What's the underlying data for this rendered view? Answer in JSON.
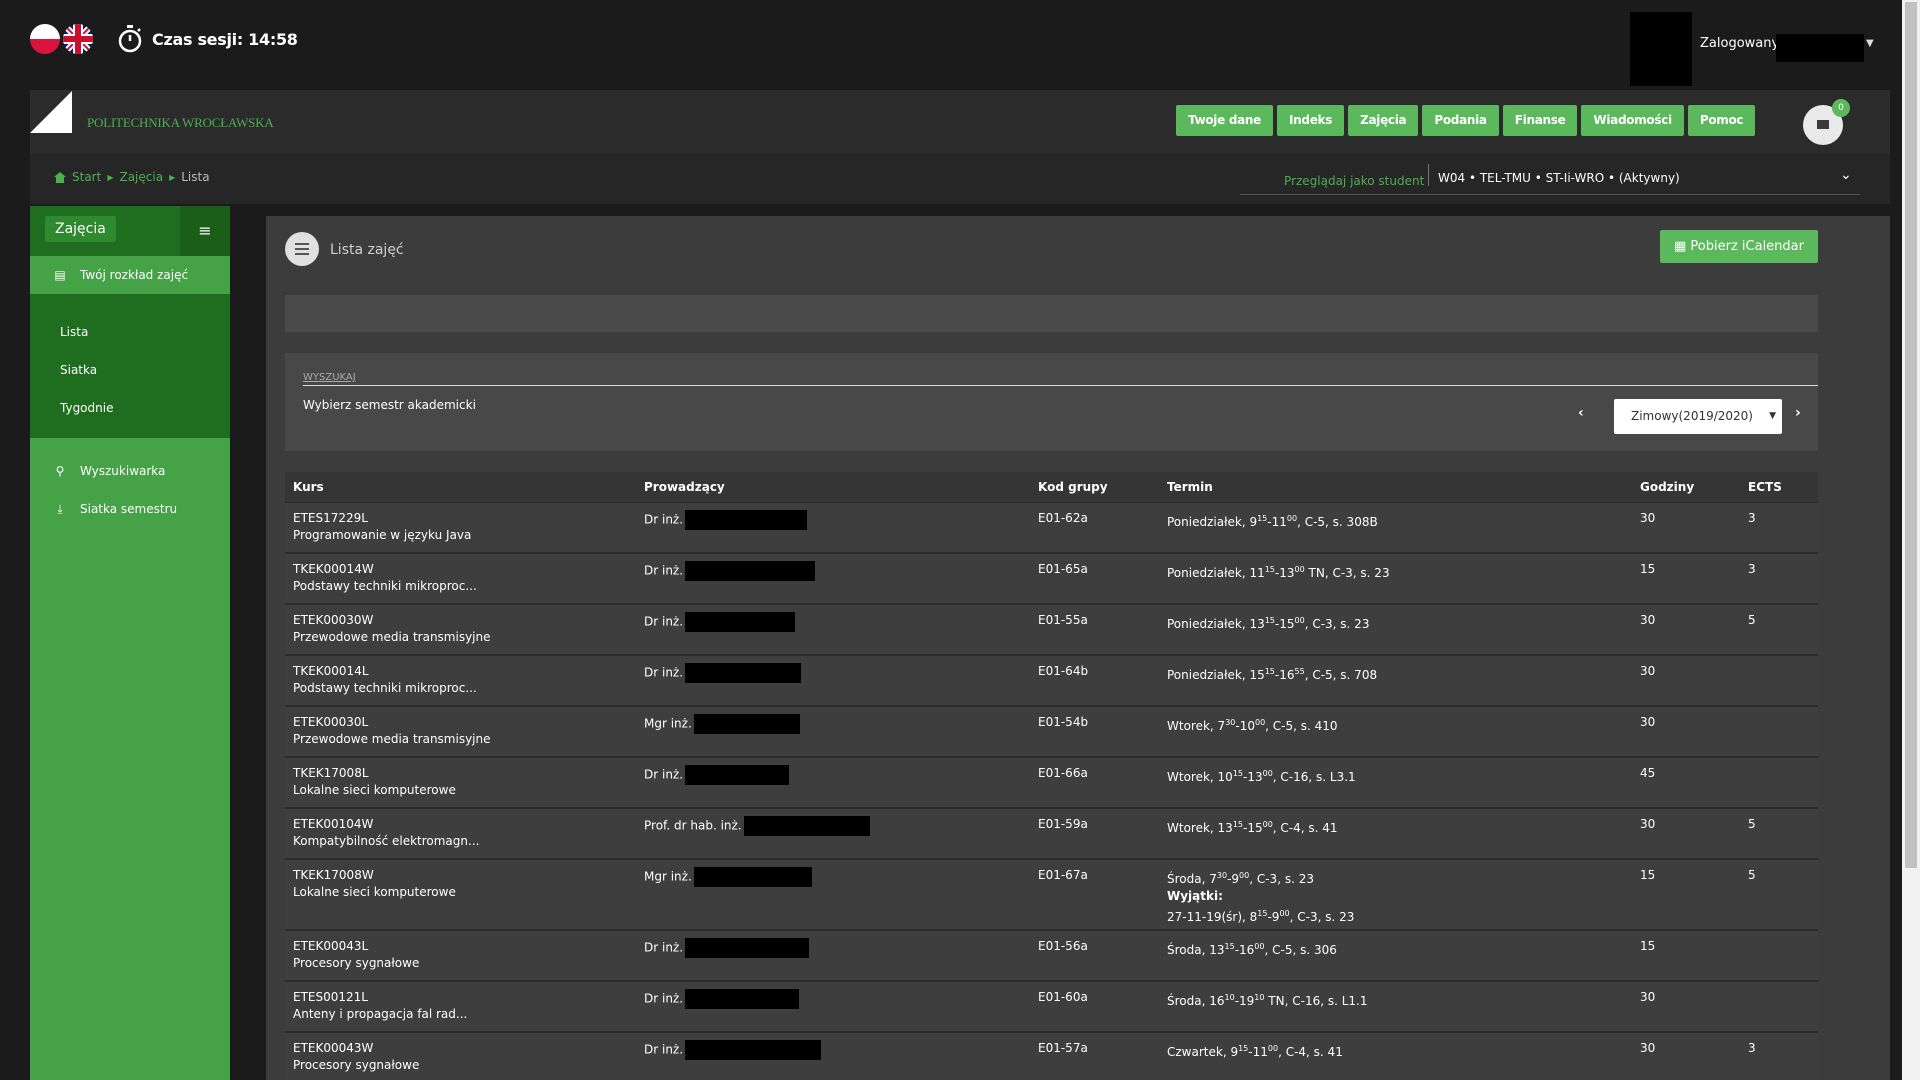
{
  "header": {
    "session_label": "Czas sesji: 14:58",
    "logged_label": "Zalogowany",
    "logo_text": "POLITECHNIKA WROCŁAWSKA",
    "nav": [
      "Twoje dane",
      "Indeks",
      "Zajęcia",
      "Podania",
      "Finanse",
      "Wiadomości",
      "Pomoc"
    ],
    "mail_count": "0"
  },
  "breadcrumb": {
    "start": "Start",
    "zajecia": "Zajęcia",
    "current": "Lista"
  },
  "view_as": {
    "label": "Przeglądaj jako student",
    "value": "W04 • TEL-TMU • ST-Ii-WRO • (Aktywny)"
  },
  "sidebar": {
    "title": "Zajęcia",
    "toggle": "≡",
    "schedule": "Twój rozkład zajęć",
    "sub": [
      "Lista",
      "Siatka",
      "Tygodnie"
    ],
    "search": "Wyszukiwarka",
    "semester_grid": "Siatka semestru"
  },
  "main": {
    "title": "Lista zajęć",
    "ical_button": "Pobierz iCalendar",
    "search_legend": "WYSZUKAJ",
    "semester_label": "Wybierz semestr akademicki",
    "semester_value": "Zimowy(2019/2020)"
  },
  "table": {
    "headers": [
      "Kurs",
      "Prowadzący",
      "Kod grupy",
      "Termin",
      "Godziny",
      "ECTS"
    ],
    "rows": [
      {
        "code": "ETES17229L",
        "name": "Programowanie w języku Java",
        "lecturer": "Dr inż.",
        "redact": 122,
        "group": "E01-62a",
        "t1": "Poniedziałek, 9",
        "s1": "15",
        "t2": "-11",
        "s2": "00",
        "t3": ", C-5, s. 308B",
        "hours": "30",
        "ects": "3"
      },
      {
        "code": "TKEK00014W",
        "name": "Podstawy techniki mikroproc...",
        "lecturer": "Dr inż.",
        "redact": 130,
        "group": "E01-65a",
        "t1": "Poniedziałek, 11",
        "s1": "15",
        "t2": "-13",
        "s2": "00",
        "t3": " TN, C-3, s. 23",
        "hours": "15",
        "ects": "3"
      },
      {
        "code": "ETEK00030W",
        "name": "Przewodowe media transmisyjne",
        "lecturer": "Dr inż.",
        "redact": 110,
        "group": "E01-55a",
        "t1": "Poniedziałek, 13",
        "s1": "15",
        "t2": "-15",
        "s2": "00",
        "t3": ", C-3, s. 23",
        "hours": "30",
        "ects": "5"
      },
      {
        "code": "TKEK00014L",
        "name": "Podstawy techniki mikroproc...",
        "lecturer": "Dr inż.",
        "redact": 116,
        "group": "E01-64b",
        "t1": "Poniedziałek, 15",
        "s1": "15",
        "t2": "-16",
        "s2": "55",
        "t3": ", C-5, s. 708",
        "hours": "30",
        "ects": ""
      },
      {
        "code": "ETEK00030L",
        "name": "Przewodowe media transmisyjne",
        "lecturer": "Mgr inż.",
        "redact": 106,
        "group": "E01-54b",
        "t1": "Wtorek, 7",
        "s1": "30",
        "t2": "-10",
        "s2": "00",
        "t3": ", C-5, s. 410",
        "hours": "30",
        "ects": ""
      },
      {
        "code": "TKEK17008L",
        "name": "Lokalne sieci komputerowe",
        "lecturer": "Dr inż.",
        "redact": 104,
        "group": "E01-66a",
        "t1": "Wtorek, 10",
        "s1": "15",
        "t2": "-13",
        "s2": "00",
        "t3": ", C-16, s. L3.1",
        "hours": "45",
        "ects": ""
      },
      {
        "code": "ETEK00104W",
        "name": "Kompatybilność elektromagn...",
        "lecturer": "Prof. dr hab. inż.",
        "redact": 126,
        "group": "E01-59a",
        "t1": "Wtorek, 13",
        "s1": "15",
        "t2": "-15",
        "s2": "00",
        "t3": ", C-4, s. 41",
        "hours": "30",
        "ects": "5"
      },
      {
        "code": "TKEK17008W",
        "name": "Lokalne sieci komputerowe",
        "lecturer": "Mgr inż.",
        "redact": 118,
        "group": "E01-67a",
        "t1": "Środa, 7",
        "s1": "30",
        "t2": "-9",
        "s2": "00",
        "t3": ", C-3, s. 23",
        "hours": "15",
        "ects": "5",
        "exceptions_label": "Wyjątki:",
        "ex1": "27-11-19(śr), 8",
        "ex_s1": "15",
        "ex2": "-9",
        "ex_s2": "00",
        "ex3": ", C-3, s. 23"
      },
      {
        "code": "ETEK00043L",
        "name": "Procesory sygnałowe",
        "lecturer": "Dr inż.",
        "redact": 124,
        "group": "E01-56a",
        "t1": "Środa, 13",
        "s1": "15",
        "t2": "-16",
        "s2": "00",
        "t3": ", C-5, s. 306",
        "hours": "15",
        "ects": ""
      },
      {
        "code": "ETES00121L",
        "name": "Anteny i propagacja fal rad...",
        "lecturer": "Dr inż.",
        "redact": 114,
        "group": "E01-60a",
        "t1": "Środa, 16",
        "s1": "10",
        "t2": "-19",
        "s2": "10",
        "t3": " TN, C-16, s. L1.1",
        "hours": "30",
        "ects": ""
      },
      {
        "code": "ETEK00043W",
        "name": "Procesory sygnałowe",
        "lecturer": "Dr inż.",
        "redact": 136,
        "group": "E01-57a",
        "t1": "Czwartek, 9",
        "s1": "15",
        "t2": "-11",
        "s2": "00",
        "t3": ", C-4, s. 41",
        "hours": "30",
        "ects": "3"
      }
    ]
  }
}
